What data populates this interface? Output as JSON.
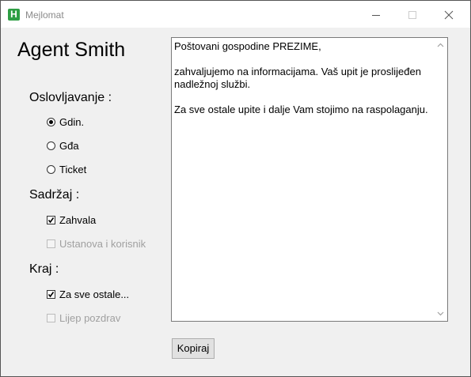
{
  "window": {
    "title": "Mejlomat",
    "app_icon_letter": "H"
  },
  "agent": {
    "name": "Agent Smith"
  },
  "greeting": {
    "label": "Oslovljavanje :",
    "options": [
      {
        "label": "Gdin.",
        "checked": true
      },
      {
        "label": "Gđa",
        "checked": false
      },
      {
        "label": "Ticket",
        "checked": false
      }
    ]
  },
  "content": {
    "label": "Sadržaj :",
    "options": [
      {
        "label": "Zahvala",
        "checked": true,
        "enabled": true
      },
      {
        "label": "Ustanova i korisnik",
        "checked": false,
        "enabled": false
      }
    ]
  },
  "ending": {
    "label": "Kraj :",
    "options": [
      {
        "label": "Za sve ostale...",
        "checked": true,
        "enabled": true
      },
      {
        "label": "Lijep pozdrav",
        "checked": false,
        "enabled": false
      }
    ]
  },
  "message": {
    "paragraphs": [
      "Poštovani gospodine PREZIME,",
      "zahvaljujemo na informacijama. Vaš upit je proslijeđen nadležnoj službi.",
      "Za sve ostale upite i dalje Vam stojimo na raspolaganju."
    ]
  },
  "copy_button": {
    "label": "Kopiraj"
  }
}
